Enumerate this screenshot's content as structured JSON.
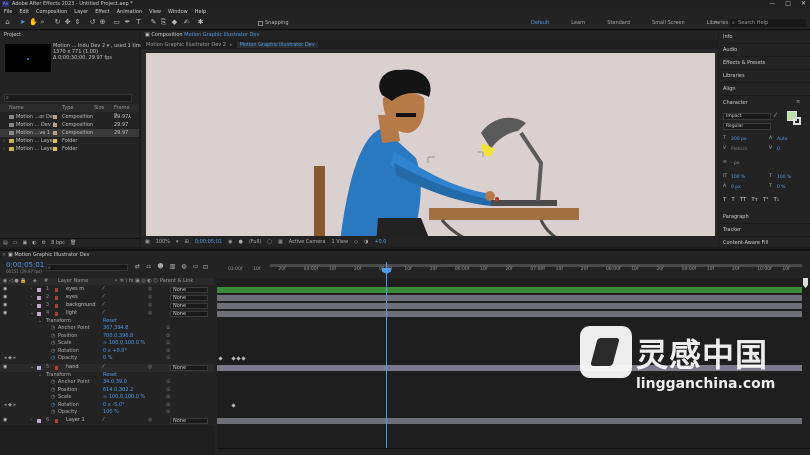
{
  "window": {
    "title": "Adobe After Effects 2023 - Untitled Project.aep *",
    "logo": "Ae",
    "controls": [
      "—",
      "□",
      "✕"
    ]
  },
  "menu": [
    "File",
    "Edit",
    "Composition",
    "Layer",
    "Effect",
    "Animation",
    "View",
    "Window",
    "Help"
  ],
  "toolbar": {
    "snapping": "Snapping",
    "workspaces": [
      "Default",
      "Learn",
      "Standard",
      "Small Screen",
      "Libraries"
    ],
    "active_workspace": "Default",
    "search_placeholder": "Search Help",
    "more": "»"
  },
  "project": {
    "tab": "Project",
    "thumb_name": "Motion ... Indu Dev 2",
    "thumb_used": "▾ , used 1 time",
    "thumb_size": "1370 x 771 (1.00)",
    "thumb_dur": "Δ 0;00;30;00, 29.97 fps",
    "columns": [
      "Name",
      "",
      "Type",
      "Size",
      "Frame R..."
    ],
    "rows": [
      {
        "name": "Motion ...or Dev",
        "type": "Composition",
        "fps": "29.97",
        "color": "#b9a28a"
      },
      {
        "name": "Motion ... Dev 2",
        "type": "Composition",
        "fps": "29.97",
        "color": "#b9a28a"
      },
      {
        "name": "Motion ...ve 1 ...",
        "type": "Composition",
        "fps": "29.97",
        "color": "#b9a28a"
      },
      {
        "name": "Motion ... Layers",
        "type": "Folder",
        "fps": "",
        "color": "#d8c24a"
      },
      {
        "name": "Motion ... Layers",
        "type": "Folder",
        "fps": "",
        "color": "#d8c24a"
      }
    ],
    "footer_bpc": "8 bpc"
  },
  "composition": {
    "tab_prefix": "Composition",
    "tab_name": "Motion Graphic Illustrator Dev",
    "view_tabs": [
      "Motion Graphic Illustrator Dev 2",
      "Motion Graphic Illustrator Dev"
    ],
    "footer": {
      "zoom": "100%",
      "time": "0;00;05;01",
      "quality": "(Full)",
      "camera": "Active Camera",
      "views": "1 View",
      "exposure": "+0.0"
    }
  },
  "right_panel": {
    "sections": [
      "Info",
      "Audio",
      "Effects & Presets",
      "Libraries",
      "Align",
      "Character",
      "Paragraph",
      "Tracker",
      "Content-Aware Fill"
    ],
    "character": {
      "font": "Impact",
      "style": "Regular",
      "size": "200 px",
      "leading": "Auto",
      "kerning": "Metrics",
      "tracking": "0",
      "stroke": "- px",
      "vscale": "100 %",
      "hscale": "100 %",
      "baseline": "0 px",
      "tsume": "0 %"
    }
  },
  "timeline": {
    "tab": "Motion Graphic Illustrator Dev",
    "timecode": "0;00;05;01",
    "fps_line": "00151 (29.97 fps)",
    "header": [
      "Layer Name",
      "Parent & Link"
    ],
    "layers": [
      {
        "n": "1",
        "name": "eyes m",
        "color": "#b03b3b",
        "parent": "None"
      },
      {
        "n": "2",
        "name": "eyes",
        "color": "#b03b3b",
        "parent": "None"
      },
      {
        "n": "3",
        "name": "background",
        "color": "#b03b3b",
        "parent": "None"
      },
      {
        "n": "4",
        "name": "light",
        "color": "#b03b3b",
        "parent": "None"
      },
      {
        "n": "5",
        "name": "hand",
        "color": "#b03b3b",
        "parent": "None"
      },
      {
        "n": "6",
        "name": "Layer 1",
        "color": "#b03b3b",
        "parent": "None"
      }
    ],
    "transform_label": "Transform",
    "reset": "Reset",
    "props_a": [
      {
        "name": "Anchor Point",
        "value": "367,394.8"
      },
      {
        "name": "Position",
        "value": "700.0,396.8"
      },
      {
        "name": "Scale",
        "value": "∞ 100.0,100.0 %"
      },
      {
        "name": "Rotation",
        "value": "0 x +0.0°"
      },
      {
        "name": "Opacity",
        "value": "0 %"
      }
    ],
    "props_b": [
      {
        "name": "Anchor Point",
        "value": "34.0,39.0"
      },
      {
        "name": "Position",
        "value": "614.0,302.2"
      },
      {
        "name": "Scale",
        "value": "∞ 100.0,100.0 %"
      },
      {
        "name": "Rotation",
        "value": "0 x -5.0°"
      },
      {
        "name": "Opacity",
        "value": "100 %"
      }
    ],
    "ruler": [
      "03:00f",
      "10f",
      "20f",
      "04:00f",
      "10f",
      "20f",
      "05:00",
      "10f",
      "20f",
      "06:00f",
      "10f",
      "20f",
      "07:00f",
      "10f",
      "20f",
      "08:00f",
      "10f",
      "20f",
      "09:00f",
      "10f",
      "20f",
      "10:00f",
      "10f"
    ]
  },
  "watermark": {
    "cn": "灵感中国",
    "en": "lingganchina.com"
  }
}
